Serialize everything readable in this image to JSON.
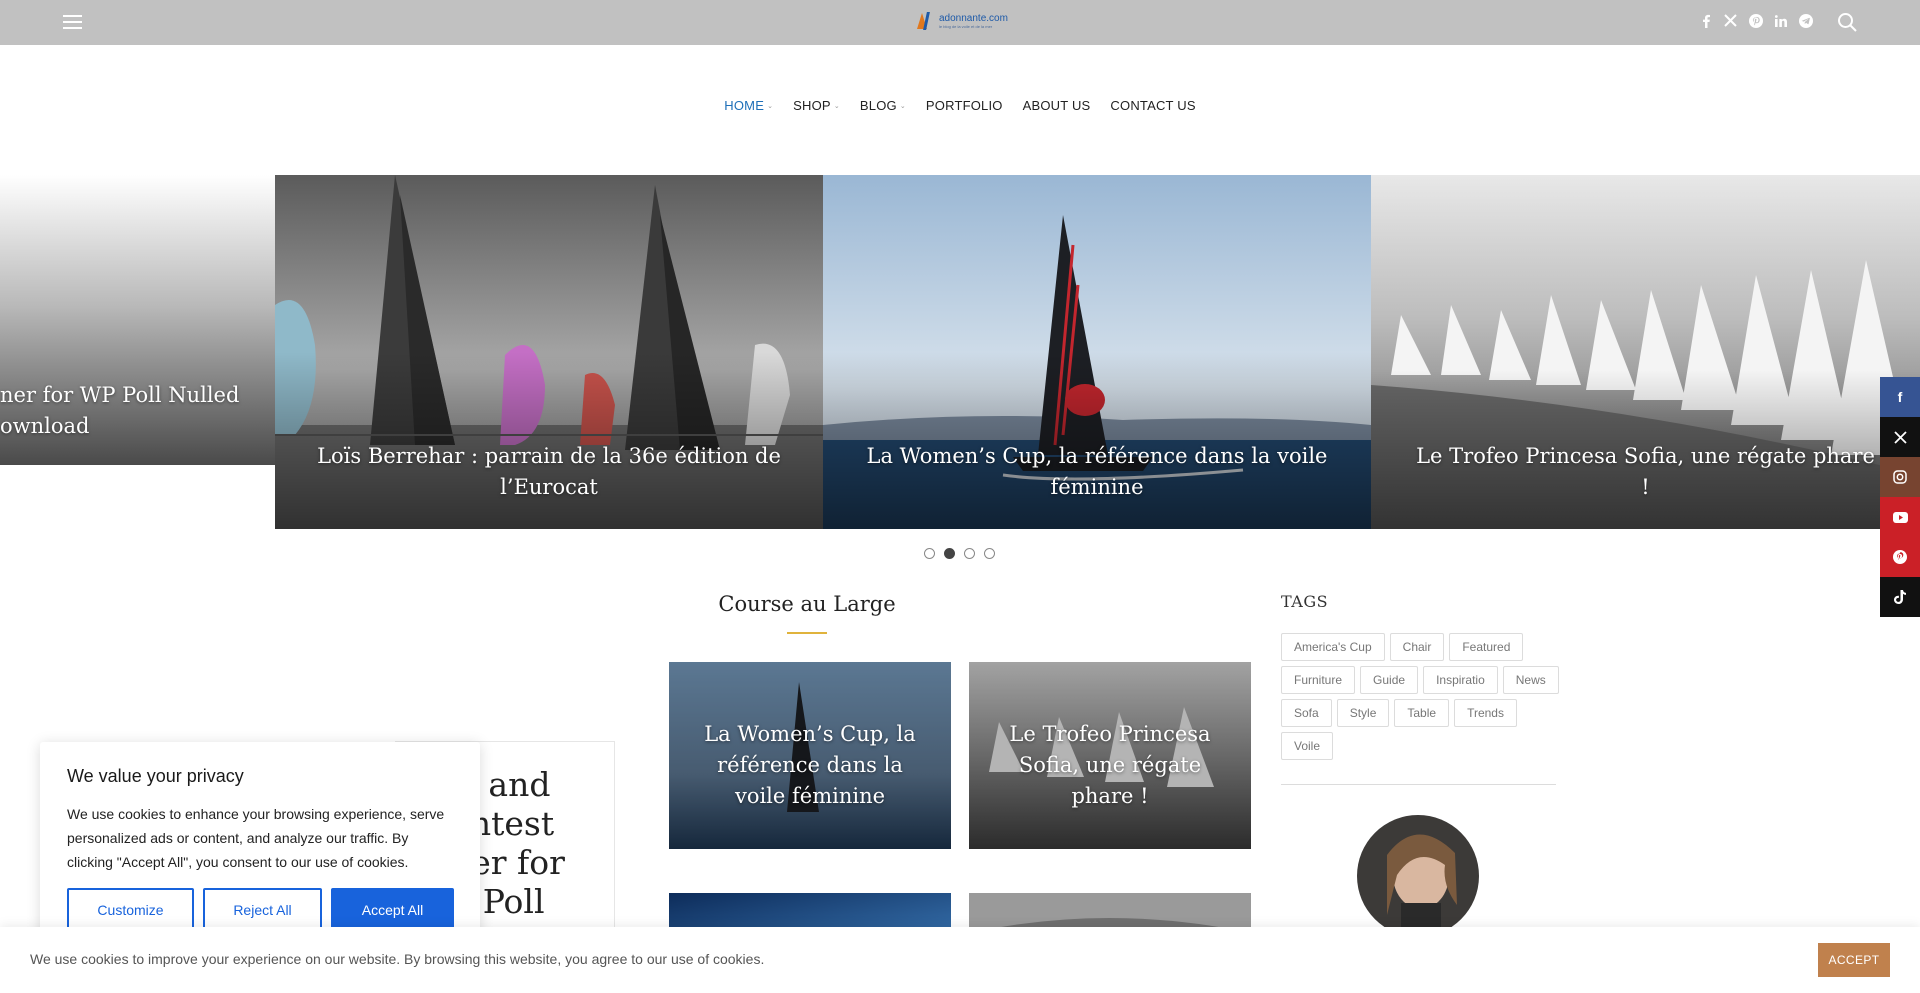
{
  "header": {
    "logo_text": "adonnante.com",
    "logo_sub": "le blog de la voile et de la mer",
    "menu_icon": "hamburger-menu-icon",
    "socials": [
      "facebook-icon",
      "x-twitter-icon",
      "pinterest-icon",
      "linkedin-icon",
      "telegram-icon"
    ],
    "search_icon": "search-icon"
  },
  "nav": {
    "items": [
      {
        "label": "HOME",
        "dropdown": true,
        "active": true
      },
      {
        "label": "SHOP",
        "dropdown": true
      },
      {
        "label": "BLOG",
        "dropdown": true
      },
      {
        "label": "PORTFOLIO"
      },
      {
        "label": "ABOUT US"
      },
      {
        "label": "CONTACT US"
      }
    ]
  },
  "slider": {
    "slides": [
      {
        "caption": "ner for WP Poll Nulled\nownload"
      },
      {
        "caption": "Loïs Berrehar : parrain de la 36e édition de l’Eurocat"
      },
      {
        "caption": "La Women’s Cup, la référence dans la voile féminine"
      },
      {
        "caption": "Le Trofeo Princesa Sofia, une régate phare !"
      }
    ],
    "dot_count": 4,
    "active_dot": 2
  },
  "section": {
    "title": "Course au Large",
    "cards": [
      {
        "caption": "La Women’s Cup, la référence dans la voile féminine"
      },
      {
        "caption": "Le Trofeo Princesa Sofia, une régate phare !"
      }
    ],
    "behind_title": "iz and\nontest\nner for\nP Poll"
  },
  "sidebar": {
    "tags_title": "TAGS",
    "tags": [
      "America's Cup",
      "Chair",
      "Featured",
      "Furniture",
      "Guide",
      "Inspiratio",
      "News",
      "Sofa",
      "Style",
      "Table",
      "Trends",
      "Voile"
    ]
  },
  "float_socials": [
    {
      "icon": "facebook-icon",
      "color": "#365493"
    },
    {
      "icon": "x-twitter-icon",
      "color": "#111111"
    },
    {
      "icon": "instagram-icon",
      "color": "#774430"
    },
    {
      "icon": "youtube-icon",
      "color": "#cb2027"
    },
    {
      "icon": "pinterest-icon",
      "color": "#cb2027"
    },
    {
      "icon": "tiktok-icon",
      "color": "#111111"
    }
  ],
  "cookie_modal": {
    "title": "We value your privacy",
    "text": "We use cookies to enhance your browsing experience, serve personalized ads or content, and analyze our traffic. By clicking \"Accept All\", you consent to our use of cookies.",
    "customize": "Customize",
    "reject": "Reject All",
    "accept": "Accept All"
  },
  "cookie_bar": {
    "text": "We use cookies to improve your experience on our website. By browsing this website, you agree to our use of cookies.",
    "accept": "ACCEPT"
  },
  "colors": {
    "topbar": "#c1c1c1",
    "nav_active": "#1e6fb8",
    "accent_underline": "#e0b33c",
    "cookie_primary": "#1863dc",
    "accept_bar_button": "#c0814d"
  }
}
